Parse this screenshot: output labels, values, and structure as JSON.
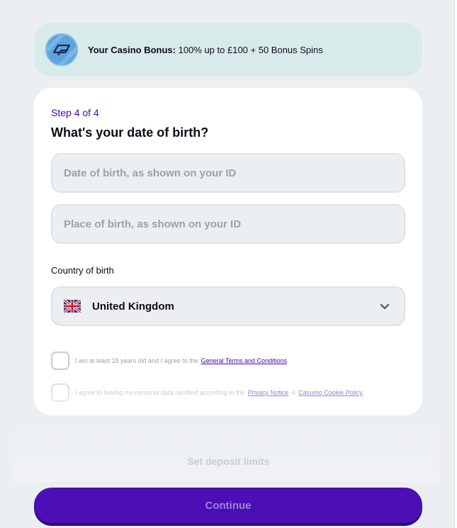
{
  "bonus": {
    "label": "Your Casino Bonus:",
    "offer": " 100% up to £100 + 50 Bonus Spins",
    "icon": "bonus-logo-icon"
  },
  "form": {
    "step": "Step 4 of 4",
    "title": "What's your date of birth?",
    "dob_placeholder": "Date of birth, as shown on your ID",
    "pob_placeholder": "Place of birth, as shown on your ID",
    "country_label": "Country of birth",
    "country_value": "United Kingdom",
    "country_flag_icon": "uk-flag-icon",
    "consent_terms_text": "I am at least 18 years old and I agree to the",
    "consent_terms_link": "General Terms and Conditions",
    "consent_privacy_text": "I agree to having my personal data handled according to the",
    "consent_privacy_link": "Privacy Notice",
    "consent_privacy_and": "&",
    "consent_cookie_link": "Casumo Cookie Policy"
  },
  "footer": {
    "deposit_limits": "Set deposit limits",
    "continue_label": "Continue"
  },
  "colors": {
    "accent": "#4b0fb5",
    "step_text": "#3f0aa6",
    "banner_bg": "#d8ebea",
    "page_bg": "#eceff2"
  }
}
